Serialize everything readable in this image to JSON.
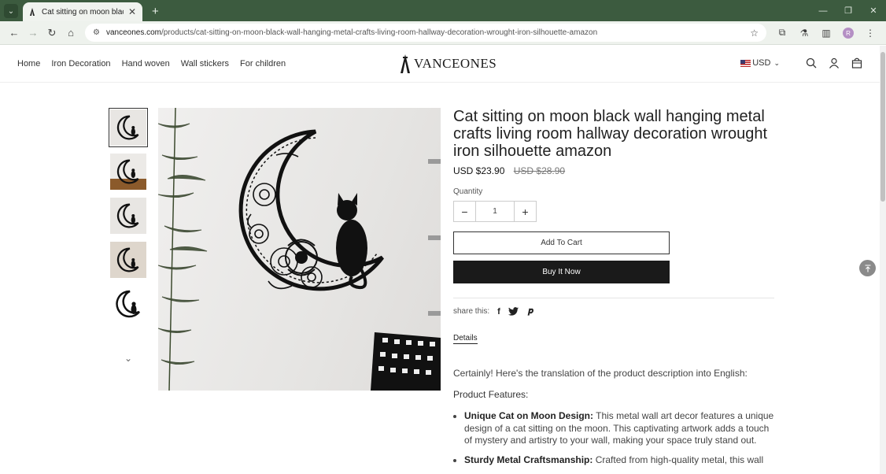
{
  "browser": {
    "tab_title": "Cat sitting on moon black wall",
    "url_domain": "vanceones.com",
    "url_path": "/products/cat-sitting-on-moon-black-wall-hanging-metal-crafts-living-room-hallway-decoration-wrought-iron-silhouette-amazon",
    "profile_initial": "R"
  },
  "header": {
    "nav": [
      "Home",
      "Iron Decoration",
      "Hand woven",
      "Wall stickers",
      "For children"
    ],
    "logo": "VANCEONES",
    "currency": "USD"
  },
  "product": {
    "title": "Cat sitting on moon black wall hanging metal crafts living room hallway decoration wrought iron silhouette amazon",
    "price": "USD $23.90",
    "old_price": "USD $28.90",
    "quantity_label": "Quantity",
    "quantity": "1",
    "add_to_cart": "Add To Cart",
    "buy_now": "Buy It Now",
    "share_label": "share this:",
    "details_tab": "Details"
  },
  "description": {
    "intro": "Certainly! Here's the translation of the product description into English:",
    "features_heading": "Product Features:",
    "features": [
      {
        "title": "Unique Cat on Moon Design:",
        "text": " This metal wall art decor features a unique design of a cat sitting on the moon. This captivating artwork adds a touch of mystery and artistry to your wall, making your space truly stand out."
      },
      {
        "title": "Sturdy Metal Craftsmanship:",
        "text": " Crafted from high-quality metal, this wall"
      }
    ]
  }
}
